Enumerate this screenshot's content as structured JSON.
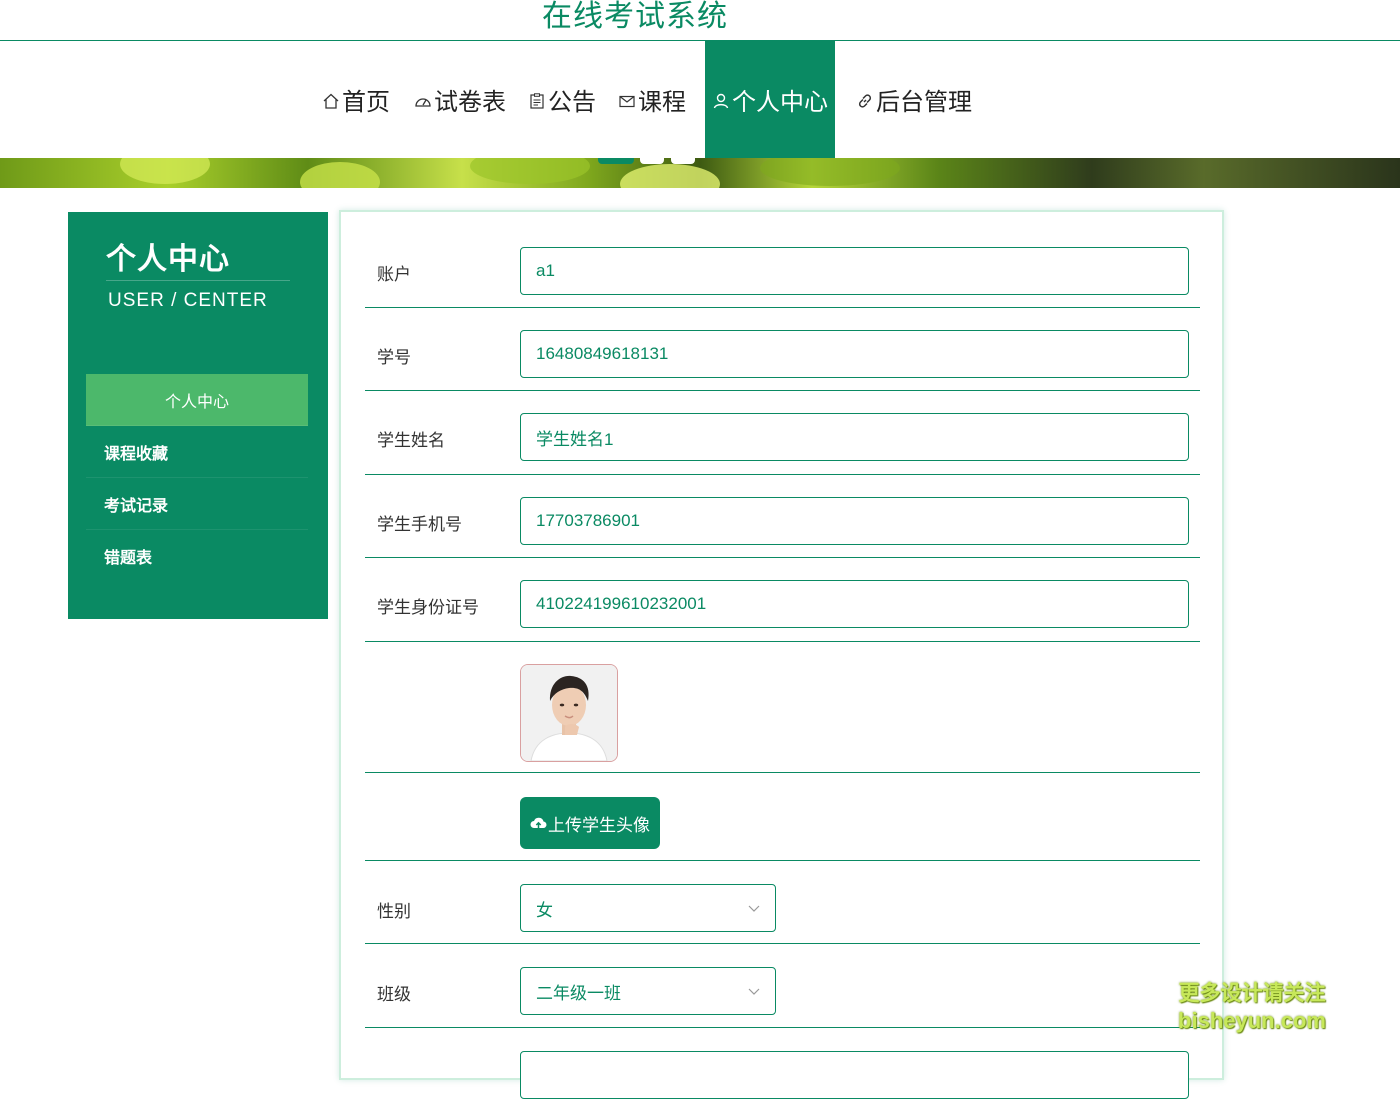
{
  "header": {
    "site_title": "在线考试系统"
  },
  "nav": {
    "items": [
      {
        "label": "首页",
        "icon": "home-icon"
      },
      {
        "label": "试卷表",
        "icon": "dashboard-icon"
      },
      {
        "label": "公告",
        "icon": "clipboard-icon"
      },
      {
        "label": "课程",
        "icon": "mail-icon"
      },
      {
        "label": "个人中心",
        "icon": "user-icon",
        "active": true
      },
      {
        "label": "后台管理",
        "icon": "link-icon"
      }
    ]
  },
  "sidebar": {
    "title": "个人中心",
    "subtitle": "USER / CENTER",
    "items": [
      {
        "label": "个人中心",
        "active": true
      },
      {
        "label": "课程收藏"
      },
      {
        "label": "考试记录"
      },
      {
        "label": "错题表"
      }
    ]
  },
  "form": {
    "account_label": "账户",
    "account_value": "a1",
    "student_no_label": "学号",
    "student_no_value": "16480849618131",
    "name_label": "学生姓名",
    "name_value": "学生姓名1",
    "phone_label": "学生手机号",
    "phone_value": "17703786901",
    "id_label": "学生身份证号",
    "id_value": "410224199610232001",
    "upload_label": "上传学生头像",
    "gender_label": "性别",
    "gender_value": "女",
    "class_label": "班级",
    "class_value": "二年级一班"
  },
  "watermark": {
    "line1": "更多设计请关注",
    "line2": "bisheyun.com"
  },
  "colors": {
    "primary": "#0a8a63",
    "sidebar_active": "#4cb86b",
    "card_border": "#cdeedd"
  }
}
